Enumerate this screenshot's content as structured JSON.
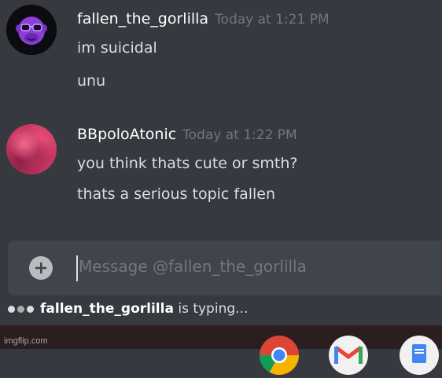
{
  "messages": [
    {
      "username": "fallen_the_gorlilla",
      "timestamp": "Today at 1:21 PM",
      "lines": [
        "im suicidal",
        "unu"
      ]
    },
    {
      "username": "BBpoloAtonic",
      "timestamp": "Today at 1:22 PM",
      "lines": [
        "you think thats cute or smth?",
        "thats a serious topic fallen"
      ]
    }
  ],
  "input": {
    "placeholder": "Message @fallen_the_gorlilla"
  },
  "typing": {
    "user": "fallen_the_gorlilla",
    "suffix": "is typing..."
  },
  "watermark": "imgflip.com",
  "taskbar_icons": [
    "chrome-icon",
    "gmail-icon",
    "google-docs-icon"
  ],
  "colors": {
    "background": "#36393f",
    "input_background": "#40444b",
    "username": "#ffffff",
    "timestamp": "#72767d",
    "message_text": "#dcddde"
  }
}
